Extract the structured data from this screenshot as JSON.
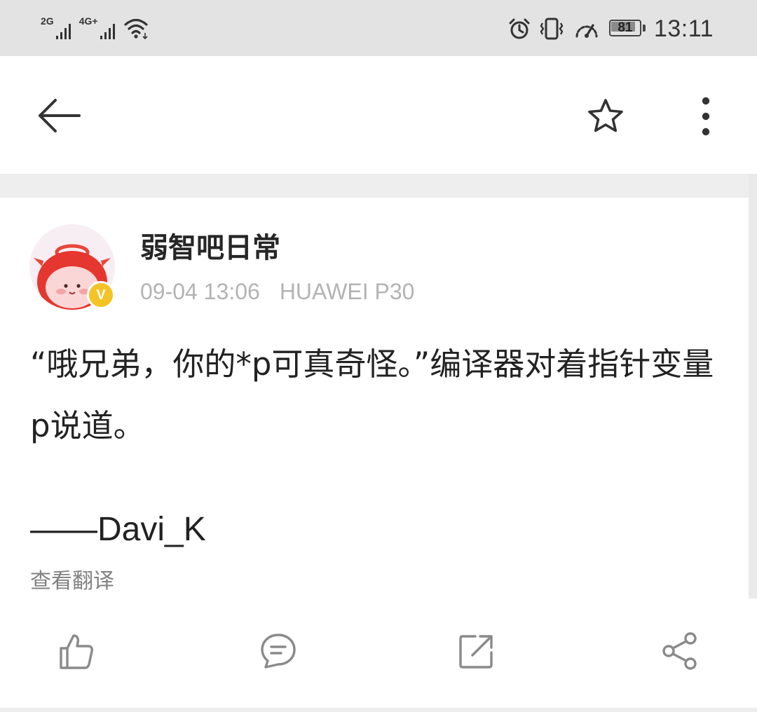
{
  "status_bar": {
    "network_1": "2G",
    "network_2": "4G+",
    "battery_level": "81",
    "time": "13:11",
    "icons": [
      "signal-icon",
      "wifi-icon",
      "alarm-icon",
      "vibrate-icon",
      "speed-icon",
      "battery-icon"
    ]
  },
  "app_bar": {
    "back_icon": "back-arrow-icon",
    "favorite_icon": "star-icon",
    "more_icon": "more-vertical-icon"
  },
  "post": {
    "author": "弱智吧日常",
    "verified_badge": "V",
    "date": "09-04 13:06",
    "device": "HUAWEI P30",
    "text": "“哦兄弟，你的*p可真奇怪。”编译器对着指针变量p说道。",
    "signature": "——Davi_K",
    "translate_label": "查看翻译"
  },
  "actions": {
    "icons": [
      "thumbs-up-icon",
      "comment-icon",
      "repost-icon",
      "share-icon"
    ]
  },
  "colors": {
    "status_bar_bg": "#e3e3e3",
    "badge": "#f4c326",
    "meta_text": "#b3b3b3",
    "link_text": "#808080",
    "icon_stroke": "#8a8a8a"
  }
}
